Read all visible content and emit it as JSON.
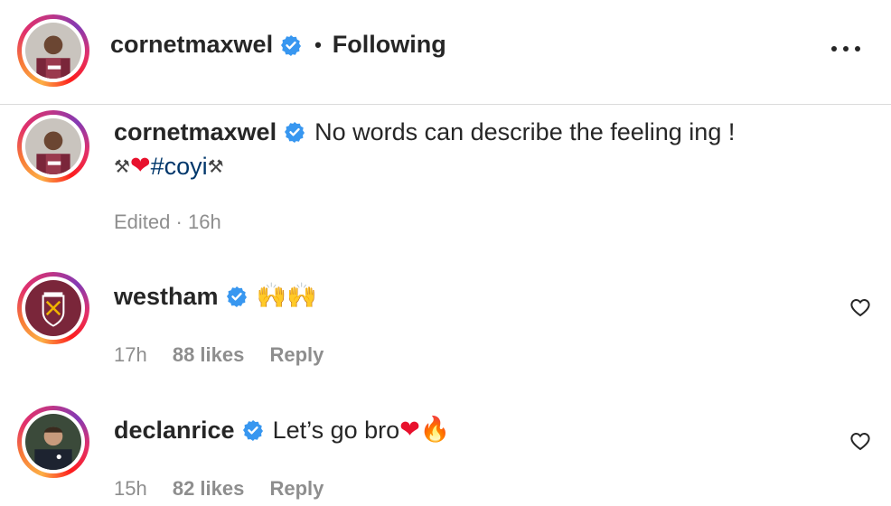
{
  "post_header": {
    "username": "cornetmaxwel",
    "separator": "•",
    "follow_state": "Following"
  },
  "caption": {
    "username": "cornetmaxwel",
    "text_line1": "No words can describe the feeling ing !",
    "line2_prefix": "⚒",
    "line2_heart": "❤",
    "hashtag": "#coyi",
    "line2_suffix": "⚒",
    "edited": "Edited",
    "dot": "·",
    "time": "16h"
  },
  "comments": [
    {
      "username": "westham",
      "text": "🙌🙌",
      "time": "17h",
      "likes": "88 likes",
      "reply": "Reply"
    },
    {
      "username": "declanrice",
      "text": "Let’s go bro",
      "emoji_heart": "❤",
      "emoji_fire": "🔥",
      "time": "15h",
      "likes": "82 likes",
      "reply": "Reply"
    }
  ],
  "colors": {
    "verified": "#3897f0",
    "meta_gray": "#8e8e8e",
    "hashtag": "#00376b",
    "claret": "#7a263a"
  },
  "icons": [
    "verified-badge-icon",
    "more-options-icon",
    "like-heart-icon"
  ]
}
